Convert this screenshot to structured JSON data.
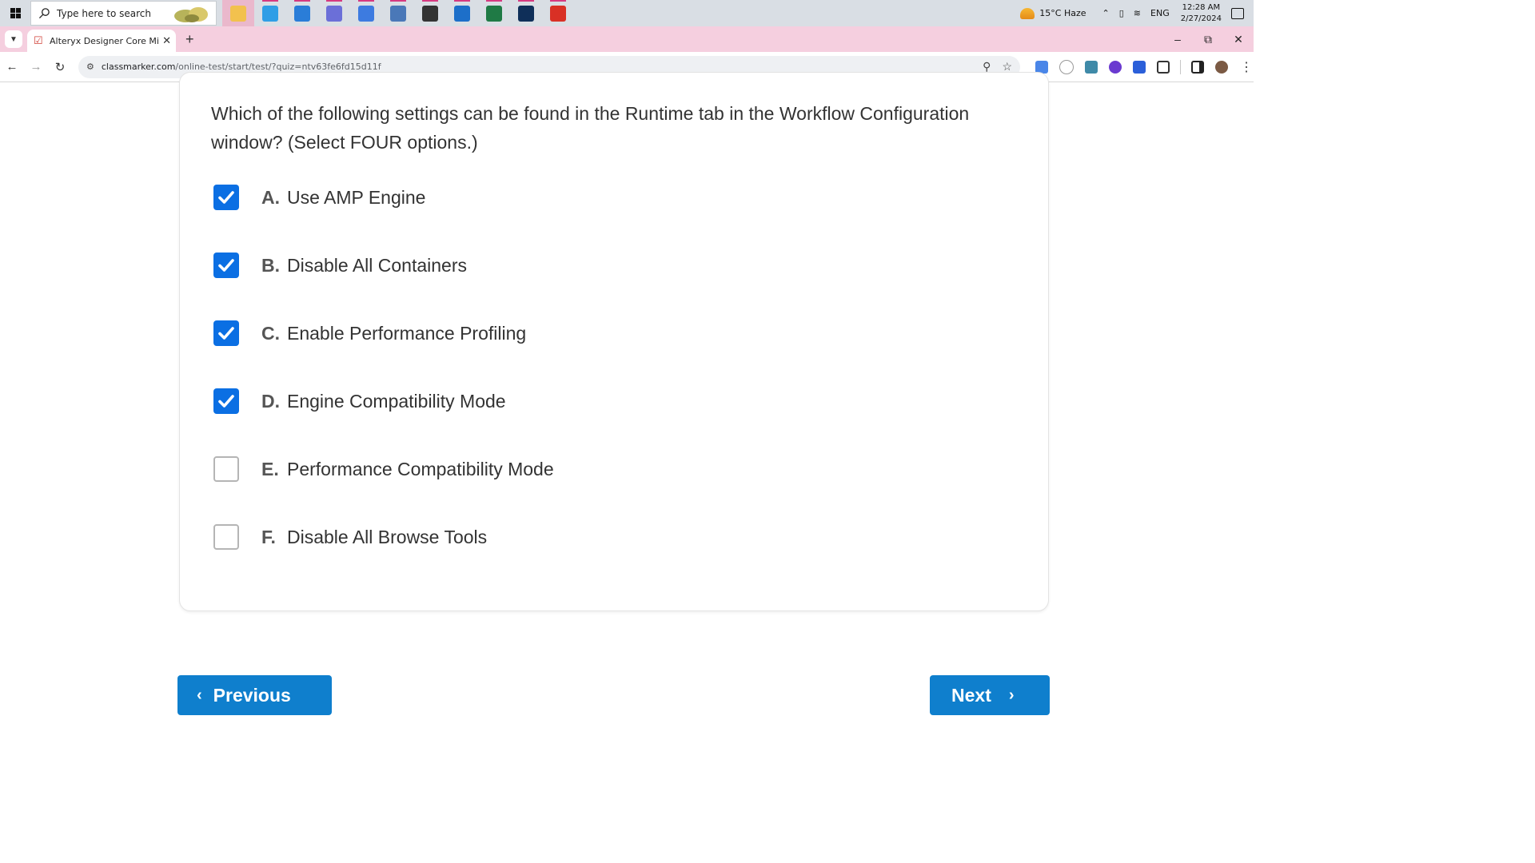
{
  "taskbar": {
    "search_placeholder": "Type here to search",
    "apps": [
      {
        "name": "file-explorer-icon",
        "color": "#f2c14e",
        "active": true
      },
      {
        "name": "edge-icon",
        "color": "#2f9ee6",
        "active": false
      },
      {
        "name": "mail-icon",
        "color": "#2a7dd8",
        "active": false
      },
      {
        "name": "copilot-icon",
        "color": "#6b6fd8",
        "active": false
      },
      {
        "name": "app-diamond-icon",
        "color": "#3d7be0",
        "active": false
      },
      {
        "name": "document-user-icon",
        "color": "#4a78b8",
        "active": false
      },
      {
        "name": "settings-gear-icon",
        "color": "#333333",
        "active": false
      },
      {
        "name": "pen-app-icon",
        "color": "#1d6fc9",
        "active": false
      },
      {
        "name": "excel-icon",
        "color": "#1f7a45",
        "active": false
      },
      {
        "name": "terminal-app-icon",
        "color": "#0f2f59",
        "active": false
      },
      {
        "name": "chrome-icon",
        "color": "#d93025",
        "active": false
      }
    ],
    "weather": "15°C  Haze",
    "language": "ENG",
    "time": "12:28 AM",
    "date": "2/27/2024"
  },
  "browser": {
    "tab_title": "Alteryx Designer Core Micro-Cr",
    "url_domain": "classmarker.com",
    "url_path": "/online-test/start/test/?quiz=ntv63fe6fd15d11f"
  },
  "question": {
    "text": "Which of the following settings can be found in the Runtime tab in the Workflow Configuration window? (Select FOUR options.)",
    "options": [
      {
        "letter": "A.",
        "label": "Use AMP Engine",
        "checked": true
      },
      {
        "letter": "B.",
        "label": "Disable All Containers",
        "checked": true
      },
      {
        "letter": "C.",
        "label": "Enable Performance Profiling",
        "checked": true
      },
      {
        "letter": "D.",
        "label": "Engine Compatibility Mode",
        "checked": true
      },
      {
        "letter": "E.",
        "label": "Performance Compatibility Mode",
        "checked": false
      },
      {
        "letter": "F.",
        "label": "Disable All Browse Tools",
        "checked": false
      }
    ]
  },
  "navigation": {
    "previous_label": "Previous",
    "next_label": "Next"
  },
  "colors": {
    "checkbox_checked": "#0b6fe3",
    "nav_button": "#0f7fcd",
    "tab_strip": "#f5cfdf"
  }
}
